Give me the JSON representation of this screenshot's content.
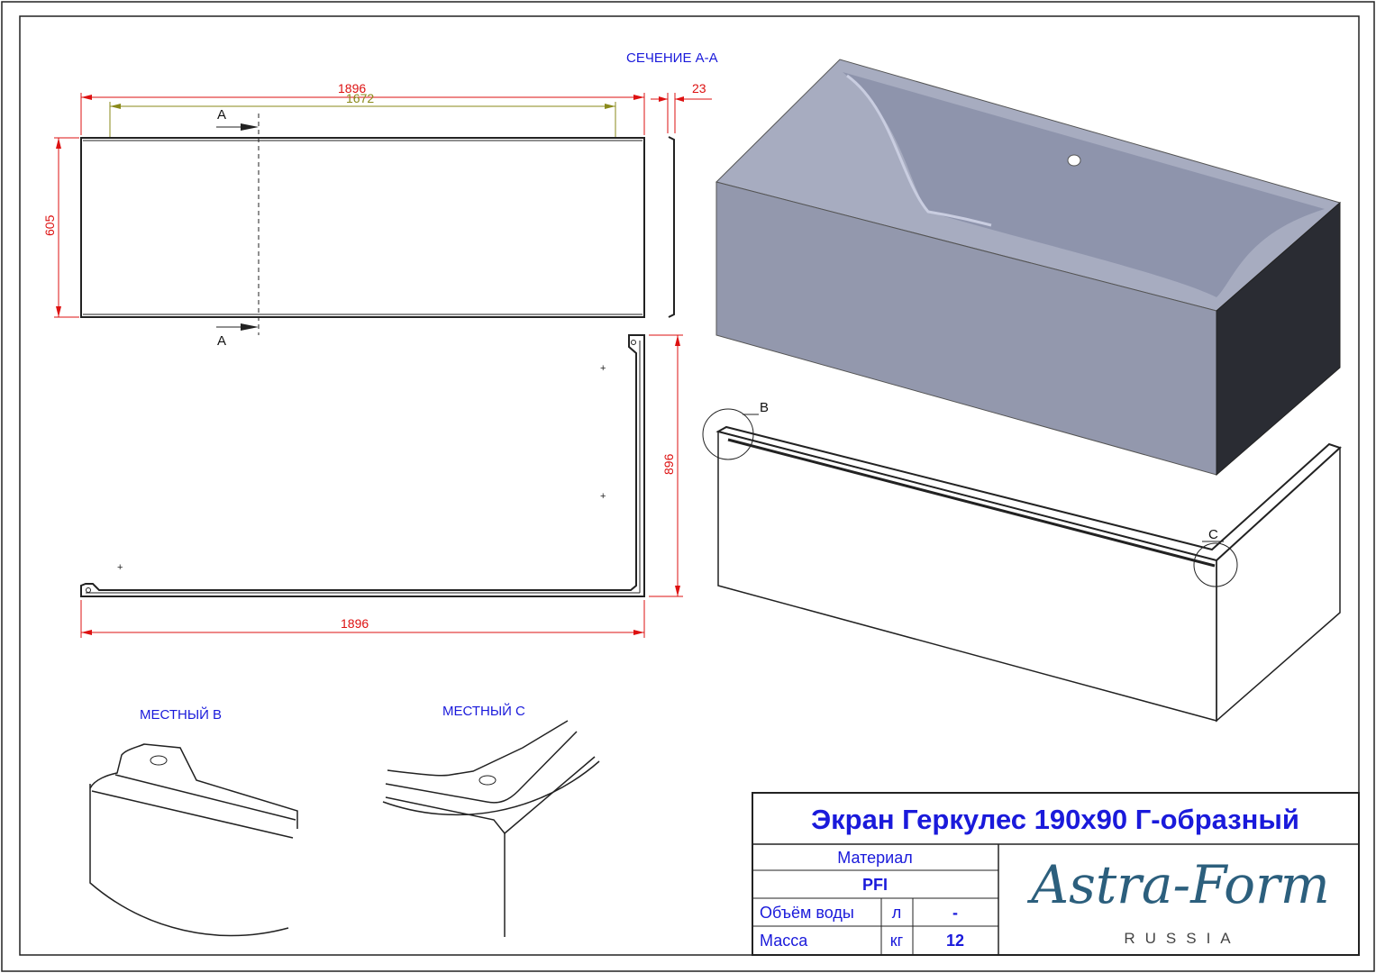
{
  "views": {
    "section_label": "СЕЧЕНИЕ А-А",
    "section_marker": "A",
    "local_b_label": "МЕСТНЫЙ В",
    "local_c_label": "МЕСТНЫЙ С",
    "callout_b": "B",
    "callout_c": "C"
  },
  "dimensions": {
    "front_length": "1896",
    "inner_length": "1672",
    "thickness": "23",
    "height": "605",
    "side_length": "896",
    "bottom_length": "1896"
  },
  "title_block": {
    "title": "Экран Геркулес 190x90 Г-образный",
    "material_label": "Материал",
    "material_value": "PFI",
    "water_volume_label": "Объём воды",
    "water_volume_unit": "л",
    "water_volume_value": "-",
    "mass_label": "Масса",
    "mass_unit": "кг",
    "mass_value": "12"
  },
  "logo": {
    "name": "Astra-Form",
    "sub": "RUSSIA"
  },
  "colors": {
    "dimension": "#d11111",
    "annotation": "#1a1adb",
    "tub_shell": "#9ba1b6",
    "tub_side": "#2a2c33",
    "logo": "#2c5f7d"
  }
}
